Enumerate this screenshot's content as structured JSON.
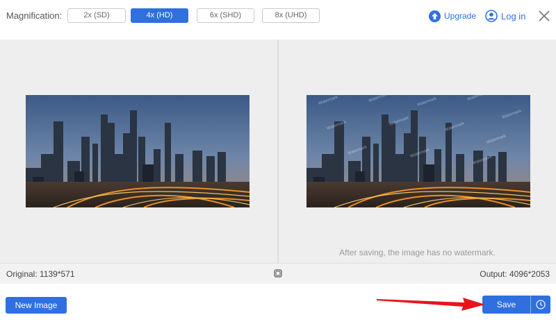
{
  "topbar": {
    "magnification_label": "Magnification:",
    "options": [
      "2x (SD)",
      "4x (HD)",
      "6x (SHD)",
      "8x (UHD)"
    ],
    "selected": "4x (HD)",
    "upgrade_label": "Upgrade",
    "login_label": "Log in"
  },
  "preview": {
    "watermark_note": "After saving, the image has no watermark.",
    "watermark_text": "Watermark"
  },
  "infobar": {
    "original": "Original: 1139*571",
    "output": "Output: 4096*2053"
  },
  "bottombar": {
    "new_image_label": "New Image",
    "save_label": "Save"
  },
  "colors": {
    "accent": "#2f6fe0",
    "annotation_arrow": "#e8141a",
    "workspace_bg": "#eeeeee"
  },
  "icons": [
    "upgrade-icon",
    "user-icon",
    "close-icon",
    "compare-icon",
    "history-icon",
    "red-arrow-annotation"
  ]
}
